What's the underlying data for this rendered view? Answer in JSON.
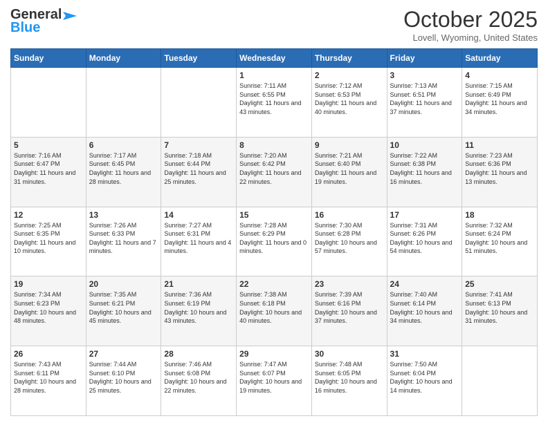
{
  "logo": {
    "line1": "General",
    "line2": "Blue"
  },
  "title": "October 2025",
  "location": "Lovell, Wyoming, United States",
  "days_of_week": [
    "Sunday",
    "Monday",
    "Tuesday",
    "Wednesday",
    "Thursday",
    "Friday",
    "Saturday"
  ],
  "weeks": [
    [
      {
        "day": "",
        "sunrise": "",
        "sunset": "",
        "daylight": ""
      },
      {
        "day": "",
        "sunrise": "",
        "sunset": "",
        "daylight": ""
      },
      {
        "day": "",
        "sunrise": "",
        "sunset": "",
        "daylight": ""
      },
      {
        "day": "1",
        "sunrise": "Sunrise: 7:11 AM",
        "sunset": "Sunset: 6:55 PM",
        "daylight": "Daylight: 11 hours and 43 minutes."
      },
      {
        "day": "2",
        "sunrise": "Sunrise: 7:12 AM",
        "sunset": "Sunset: 6:53 PM",
        "daylight": "Daylight: 11 hours and 40 minutes."
      },
      {
        "day": "3",
        "sunrise": "Sunrise: 7:13 AM",
        "sunset": "Sunset: 6:51 PM",
        "daylight": "Daylight: 11 hours and 37 minutes."
      },
      {
        "day": "4",
        "sunrise": "Sunrise: 7:15 AM",
        "sunset": "Sunset: 6:49 PM",
        "daylight": "Daylight: 11 hours and 34 minutes."
      }
    ],
    [
      {
        "day": "5",
        "sunrise": "Sunrise: 7:16 AM",
        "sunset": "Sunset: 6:47 PM",
        "daylight": "Daylight: 11 hours and 31 minutes."
      },
      {
        "day": "6",
        "sunrise": "Sunrise: 7:17 AM",
        "sunset": "Sunset: 6:45 PM",
        "daylight": "Daylight: 11 hours and 28 minutes."
      },
      {
        "day": "7",
        "sunrise": "Sunrise: 7:18 AM",
        "sunset": "Sunset: 6:44 PM",
        "daylight": "Daylight: 11 hours and 25 minutes."
      },
      {
        "day": "8",
        "sunrise": "Sunrise: 7:20 AM",
        "sunset": "Sunset: 6:42 PM",
        "daylight": "Daylight: 11 hours and 22 minutes."
      },
      {
        "day": "9",
        "sunrise": "Sunrise: 7:21 AM",
        "sunset": "Sunset: 6:40 PM",
        "daylight": "Daylight: 11 hours and 19 minutes."
      },
      {
        "day": "10",
        "sunrise": "Sunrise: 7:22 AM",
        "sunset": "Sunset: 6:38 PM",
        "daylight": "Daylight: 11 hours and 16 minutes."
      },
      {
        "day": "11",
        "sunrise": "Sunrise: 7:23 AM",
        "sunset": "Sunset: 6:36 PM",
        "daylight": "Daylight: 11 hours and 13 minutes."
      }
    ],
    [
      {
        "day": "12",
        "sunrise": "Sunrise: 7:25 AM",
        "sunset": "Sunset: 6:35 PM",
        "daylight": "Daylight: 11 hours and 10 minutes."
      },
      {
        "day": "13",
        "sunrise": "Sunrise: 7:26 AM",
        "sunset": "Sunset: 6:33 PM",
        "daylight": "Daylight: 11 hours and 7 minutes."
      },
      {
        "day": "14",
        "sunrise": "Sunrise: 7:27 AM",
        "sunset": "Sunset: 6:31 PM",
        "daylight": "Daylight: 11 hours and 4 minutes."
      },
      {
        "day": "15",
        "sunrise": "Sunrise: 7:28 AM",
        "sunset": "Sunset: 6:29 PM",
        "daylight": "Daylight: 11 hours and 0 minutes."
      },
      {
        "day": "16",
        "sunrise": "Sunrise: 7:30 AM",
        "sunset": "Sunset: 6:28 PM",
        "daylight": "Daylight: 10 hours and 57 minutes."
      },
      {
        "day": "17",
        "sunrise": "Sunrise: 7:31 AM",
        "sunset": "Sunset: 6:26 PM",
        "daylight": "Daylight: 10 hours and 54 minutes."
      },
      {
        "day": "18",
        "sunrise": "Sunrise: 7:32 AM",
        "sunset": "Sunset: 6:24 PM",
        "daylight": "Daylight: 10 hours and 51 minutes."
      }
    ],
    [
      {
        "day": "19",
        "sunrise": "Sunrise: 7:34 AM",
        "sunset": "Sunset: 6:23 PM",
        "daylight": "Daylight: 10 hours and 48 minutes."
      },
      {
        "day": "20",
        "sunrise": "Sunrise: 7:35 AM",
        "sunset": "Sunset: 6:21 PM",
        "daylight": "Daylight: 10 hours and 45 minutes."
      },
      {
        "day": "21",
        "sunrise": "Sunrise: 7:36 AM",
        "sunset": "Sunset: 6:19 PM",
        "daylight": "Daylight: 10 hours and 43 minutes."
      },
      {
        "day": "22",
        "sunrise": "Sunrise: 7:38 AM",
        "sunset": "Sunset: 6:18 PM",
        "daylight": "Daylight: 10 hours and 40 minutes."
      },
      {
        "day": "23",
        "sunrise": "Sunrise: 7:39 AM",
        "sunset": "Sunset: 6:16 PM",
        "daylight": "Daylight: 10 hours and 37 minutes."
      },
      {
        "day": "24",
        "sunrise": "Sunrise: 7:40 AM",
        "sunset": "Sunset: 6:14 PM",
        "daylight": "Daylight: 10 hours and 34 minutes."
      },
      {
        "day": "25",
        "sunrise": "Sunrise: 7:41 AM",
        "sunset": "Sunset: 6:13 PM",
        "daylight": "Daylight: 10 hours and 31 minutes."
      }
    ],
    [
      {
        "day": "26",
        "sunrise": "Sunrise: 7:43 AM",
        "sunset": "Sunset: 6:11 PM",
        "daylight": "Daylight: 10 hours and 28 minutes."
      },
      {
        "day": "27",
        "sunrise": "Sunrise: 7:44 AM",
        "sunset": "Sunset: 6:10 PM",
        "daylight": "Daylight: 10 hours and 25 minutes."
      },
      {
        "day": "28",
        "sunrise": "Sunrise: 7:46 AM",
        "sunset": "Sunset: 6:08 PM",
        "daylight": "Daylight: 10 hours and 22 minutes."
      },
      {
        "day": "29",
        "sunrise": "Sunrise: 7:47 AM",
        "sunset": "Sunset: 6:07 PM",
        "daylight": "Daylight: 10 hours and 19 minutes."
      },
      {
        "day": "30",
        "sunrise": "Sunrise: 7:48 AM",
        "sunset": "Sunset: 6:05 PM",
        "daylight": "Daylight: 10 hours and 16 minutes."
      },
      {
        "day": "31",
        "sunrise": "Sunrise: 7:50 AM",
        "sunset": "Sunset: 6:04 PM",
        "daylight": "Daylight: 10 hours and 14 minutes."
      },
      {
        "day": "",
        "sunrise": "",
        "sunset": "",
        "daylight": ""
      }
    ]
  ]
}
